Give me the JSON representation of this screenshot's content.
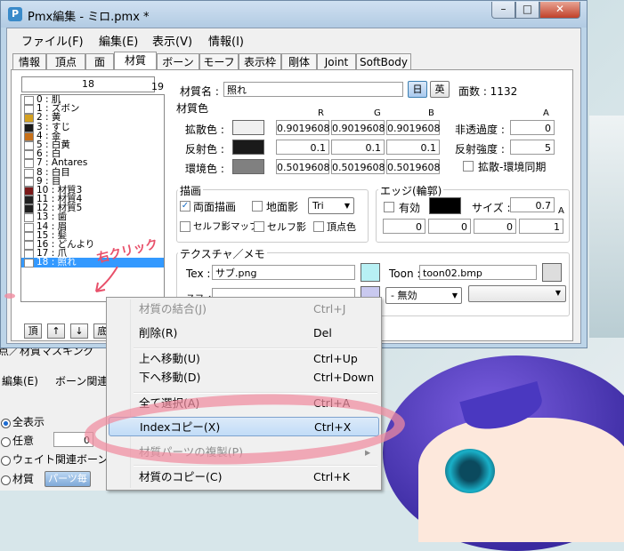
{
  "window": {
    "title": "Pmx編集 - ミロ.pmx *",
    "app_icon": "P",
    "min_glyph": "–",
    "max_glyph": "□",
    "close_glyph": "✕"
  },
  "menu": {
    "file": "ファイル(F)",
    "edit": "編集(E)",
    "view": "表示(V)",
    "info": "情報(I)"
  },
  "tabs": [
    "情報",
    "頂点",
    "面",
    "材質",
    "ボーン",
    "モーフ",
    "表示枠",
    "剛体",
    "Joint",
    "SoftBody"
  ],
  "list": {
    "index_value": "18",
    "count": "19",
    "items": [
      {
        "label": "0 : 肌",
        "color": "#ffffff"
      },
      {
        "label": "1 : ズボン",
        "color": "#ffffff"
      },
      {
        "label": "2 : 黄",
        "color": "#d4a020"
      },
      {
        "label": "3 : すじ",
        "color": "#1a1a1a"
      },
      {
        "label": "4 : 金",
        "color": "#c87018"
      },
      {
        "label": "5 : 白黄",
        "color": "#ffffff"
      },
      {
        "label": "6 : 白",
        "color": "#ffffff"
      },
      {
        "label": "7 : Antares",
        "color": "#ffffff"
      },
      {
        "label": "8 : 白目",
        "color": "#ffffff"
      },
      {
        "label": "9 : 目",
        "color": "#ffffff"
      },
      {
        "label": "10 : 材質3",
        "color": "#7a1818"
      },
      {
        "label": "11 : 材質4",
        "color": "#202020"
      },
      {
        "label": "12 : 材質5",
        "color": "#202020"
      },
      {
        "label": "13 : 歯",
        "color": "#ffffff"
      },
      {
        "label": "14 : 眉",
        "color": "#ffffff"
      },
      {
        "label": "15 : 髪",
        "color": "#ffffff"
      },
      {
        "label": "16 : どんより",
        "color": "#ffffff"
      },
      {
        "label": "17 : 爪",
        "color": "#ffffff"
      },
      {
        "label": "18 : 照れ",
        "color": "#ffffff"
      }
    ],
    "buttons": [
      "頂",
      "↑",
      "↓",
      "底"
    ]
  },
  "material": {
    "name_label": "材質名 :",
    "name_value": "照れ",
    "jp_btn": "日",
    "en_btn": "英",
    "face_count": "面数 : 1132",
    "color_group": "材質色",
    "col_r": "R",
    "col_g": "G",
    "col_b": "B",
    "col_a": "A",
    "diffuse_label": "拡散色 :",
    "diffuse": [
      "0.9019608",
      "0.9019608",
      "0.9019608"
    ],
    "diffuse_swatch": "#f0f0f0",
    "specular_label": "反射色 :",
    "specular": [
      "0.1",
      "0.1",
      "0.1"
    ],
    "specular_swatch": "#1a1a1a",
    "ambient_label": "環境色 :",
    "ambient": [
      "0.5019608",
      "0.5019608",
      "0.5019608"
    ],
    "ambient_swatch": "#808080",
    "alpha_label": "非透過度 :",
    "alpha": "0",
    "spec_power_label": "反射強度 :",
    "spec_power": "5",
    "sync_label": "拡散-環境同期"
  },
  "draw": {
    "group": "描画",
    "double_sided": "両面描画",
    "ground_shadow": "地面影",
    "tri_option": "Tri",
    "self_shadow_map": "セルフ影マップ",
    "self_shadow": "セルフ影",
    "vertex_color": "頂点色"
  },
  "edge": {
    "group": "エッジ(輪郭)",
    "enabled": "有効",
    "size_label": "サイズ :",
    "size": "0.7",
    "a_label": "A",
    "rgba": [
      "0",
      "0",
      "0",
      "1"
    ]
  },
  "texture": {
    "group": "テクスチャ／メモ",
    "tex_label": "Tex :",
    "tex_value": "サブ.png",
    "toon_label": "Toon :",
    "toon_value": "toon02.bmp",
    "sphere_label": "スフィア",
    "sphere_mode": "- 無効"
  },
  "context_menu": {
    "items": [
      {
        "label": "材質の結合(J)",
        "shortcut": "Ctrl+J",
        "disabled": true
      },
      {
        "label": "削除(R)",
        "shortcut": "Del",
        "disabled": false
      },
      {
        "label": "上へ移動(U)",
        "shortcut": "Ctrl+Up",
        "disabled": false
      },
      {
        "label": "下へ移動(D)",
        "shortcut": "Ctrl+Down",
        "disabled": false
      },
      {
        "label": "全て選択(A)",
        "shortcut": "Ctrl+A",
        "disabled": false
      },
      {
        "label": "Indexコピー(X)",
        "shortcut": "Ctrl+X",
        "disabled": false
      },
      {
        "label": "材質パーツの複製(P)",
        "shortcut": "",
        "disabled": true
      },
      {
        "label": "材質のコピー(C)",
        "shortcut": "Ctrl+K",
        "disabled": false
      }
    ],
    "submenu_arrow": "▸"
  },
  "second_window": {
    "title": "点／材質マスキング",
    "menu_edit": "編集(E)",
    "menu_bone": "ボーン関連",
    "opt_all": "全表示",
    "opt_any": "任意",
    "opt_weight": "ウェイト関連ボーン",
    "opt_material": "材質",
    "btn_parts": "パーツ毎",
    "any_value": "0"
  },
  "annotation": {
    "right_click": "右クリック"
  }
}
